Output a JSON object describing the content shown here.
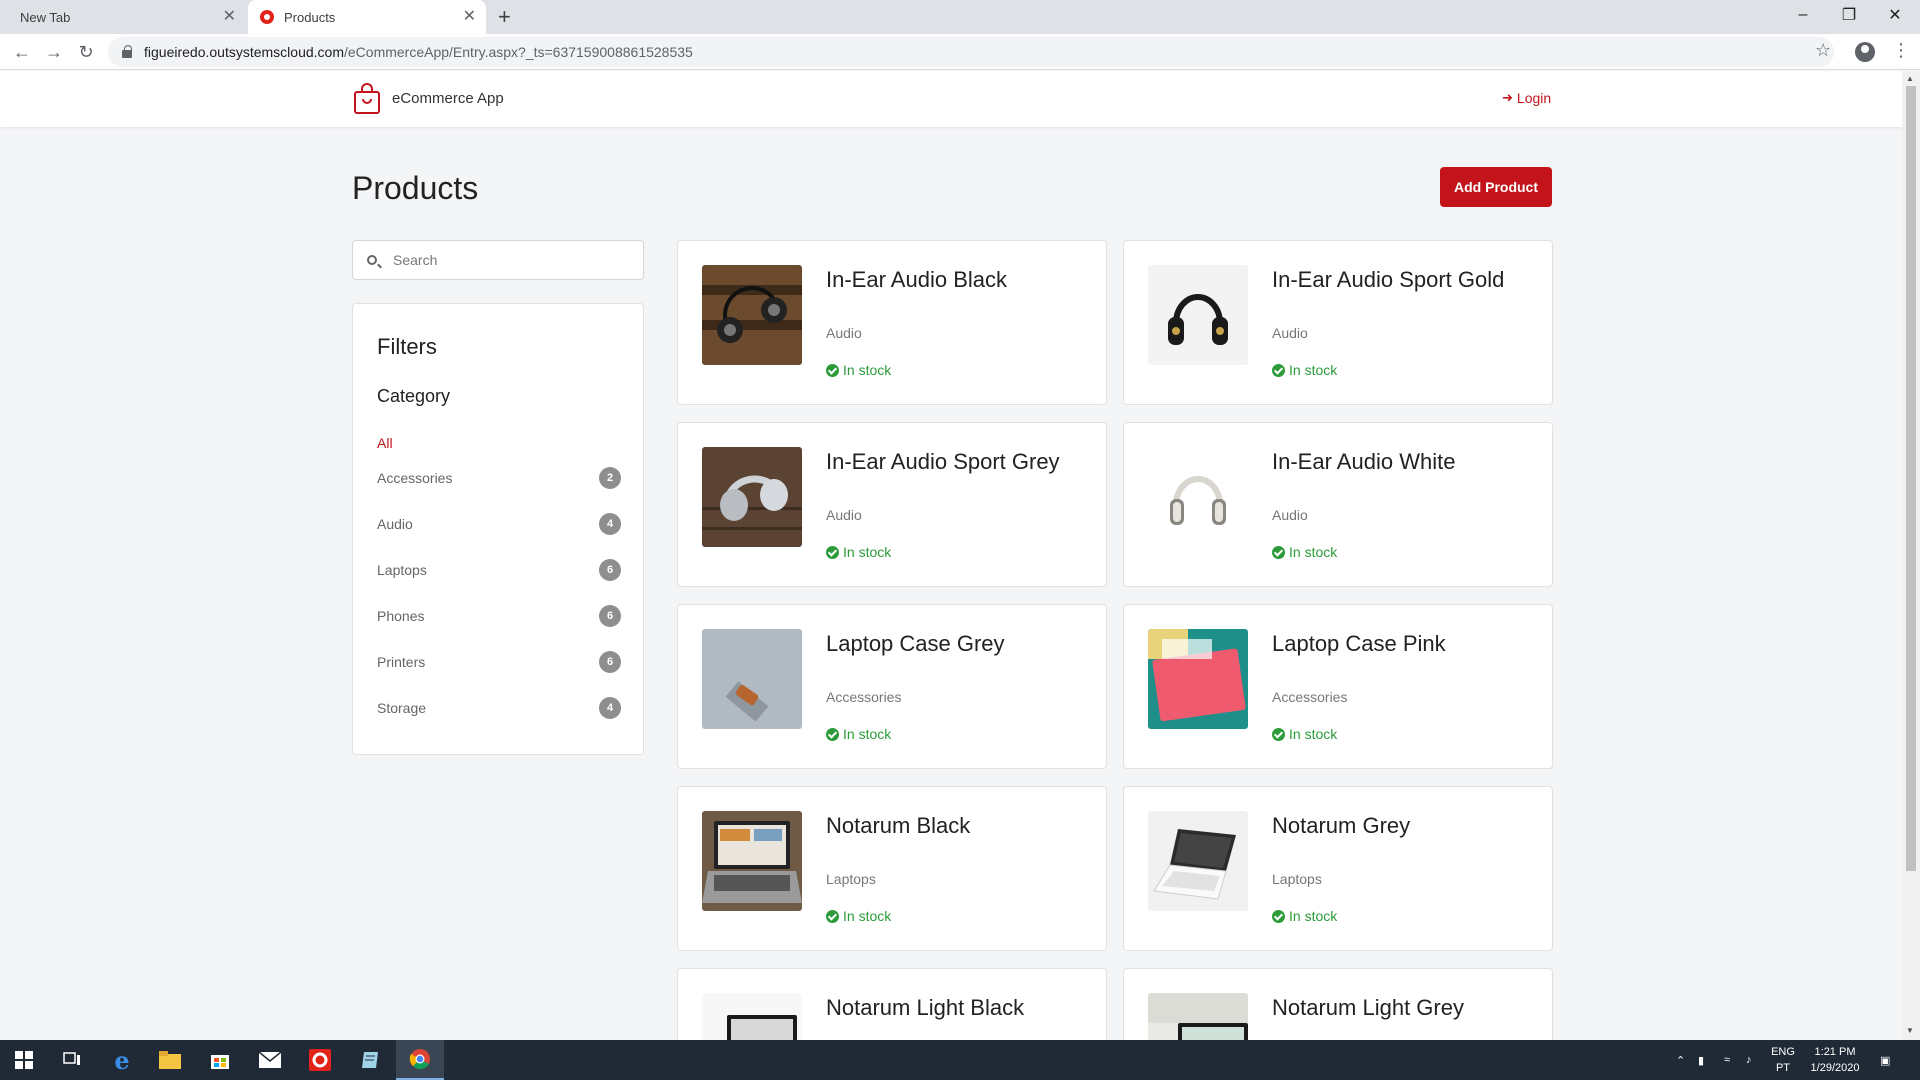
{
  "browser": {
    "tabs": [
      {
        "label": "New Tab",
        "active": false
      },
      {
        "label": "Products",
        "active": true
      }
    ],
    "url_host": "figueiredo.outsystemscloud.com",
    "url_path": "/eCommerceApp/Entry.aspx?_ts=637159008861528535"
  },
  "header": {
    "app_name": "eCommerce App",
    "login_label": "Login"
  },
  "page": {
    "title": "Products",
    "add_button_label": "Add Product",
    "search_placeholder": "Search"
  },
  "filters": {
    "title": "Filters",
    "category_heading": "Category",
    "all_label": "All",
    "categories": [
      {
        "label": "Accessories",
        "count": "2"
      },
      {
        "label": "Audio",
        "count": "4"
      },
      {
        "label": "Laptops",
        "count": "6"
      },
      {
        "label": "Phones",
        "count": "6"
      },
      {
        "label": "Printers",
        "count": "6"
      },
      {
        "label": "Storage",
        "count": "4"
      }
    ]
  },
  "products": [
    {
      "name": "In-Ear Audio Black",
      "category": "Audio",
      "stock": "In stock",
      "image": "headphones-on-wood"
    },
    {
      "name": "In-Ear Audio Sport Gold",
      "category": "Audio",
      "stock": "In stock",
      "image": "headphones-black-gold"
    },
    {
      "name": "In-Ear Audio Sport Grey",
      "category": "Audio",
      "stock": "In stock",
      "image": "headphones-grey-on-table"
    },
    {
      "name": "In-Ear Audio White",
      "category": "Audio",
      "stock": "In stock",
      "image": "headphones-white"
    },
    {
      "name": "Laptop Case Grey",
      "category": "Accessories",
      "stock": "In stock",
      "image": "felt-case-grey"
    },
    {
      "name": "Laptop Case Pink",
      "category": "Accessories",
      "stock": "In stock",
      "image": "case-pink"
    },
    {
      "name": "Notarum Black",
      "category": "Laptops",
      "stock": "In stock",
      "image": "laptop-dark"
    },
    {
      "name": "Notarum Grey",
      "category": "Laptops",
      "stock": "In stock",
      "image": "laptop-white"
    },
    {
      "name": "Notarum Light Black",
      "category": "",
      "stock": "",
      "image": "laptop-light-black"
    },
    {
      "name": "Notarum Light Grey",
      "category": "",
      "stock": "",
      "image": "laptop-light-grey"
    }
  ],
  "taskbar": {
    "lang_top": "ENG",
    "lang_bottom": "PT",
    "time": "1:21 PM",
    "date": "1/29/2020"
  },
  "colors": {
    "accent": "#c3141b",
    "stock_green": "#2d9b3a",
    "page_bg": "#f4f5f7",
    "taskbar": "#1f2a36"
  }
}
